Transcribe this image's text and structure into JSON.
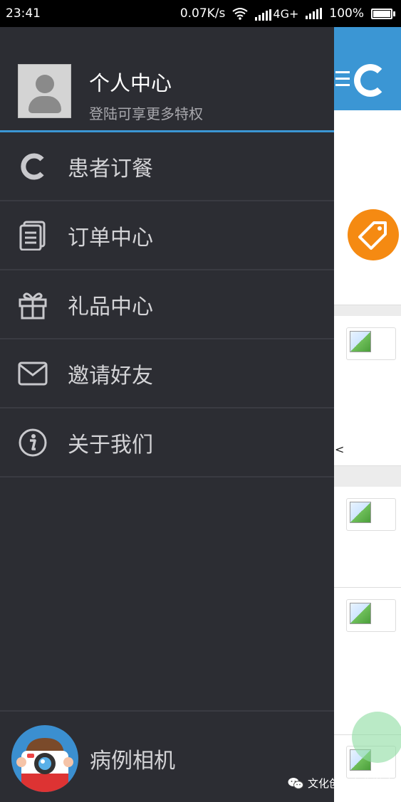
{
  "status_bar": {
    "time": "23:41",
    "net_speed": "0.07K/s",
    "network_type": "4G+",
    "battery": "100%"
  },
  "drawer": {
    "profile": {
      "name": "个人中心",
      "subtitle": "登陆可享更多特权"
    },
    "menu": [
      {
        "label": "患者订餐",
        "icon": "logo-c-icon"
      },
      {
        "label": "订单中心",
        "icon": "order-document-icon"
      },
      {
        "label": "礼品中心",
        "icon": "gift-icon"
      },
      {
        "label": "邀请好友",
        "icon": "envelope-icon"
      },
      {
        "label": "关于我们",
        "icon": "info-icon"
      }
    ],
    "bottom": {
      "label": "病例相机",
      "icon": "camera-mascot-icon"
    }
  },
  "background": {
    "lt_char": "<"
  },
  "watermark": {
    "text": "文化创意产业学院",
    "icon": "wechat-icon"
  },
  "colors": {
    "drawer_bg": "#2c2d33",
    "accent_blue": "#3b96d4",
    "tag_orange": "#f58a12",
    "menu_text": "#d3d3d6"
  }
}
